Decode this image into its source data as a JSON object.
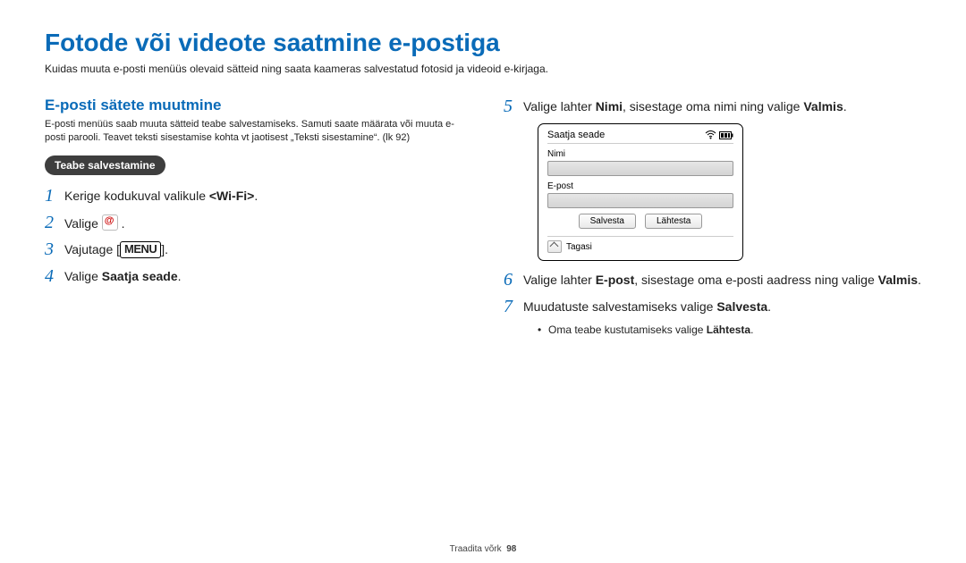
{
  "title": "Fotode või videote saatmine e-postiga",
  "intro": "Kuidas muuta e-posti menüüs olevaid sätteid ning saata kaameras salvestatud fotosid ja videoid e-kirjaga.",
  "left": {
    "subhead": "E-posti sätete muutmine",
    "subdesc": "E-posti menüüs saab muuta sätteid teabe salvestamiseks. Samuti saate määrata või muuta e-posti parooli. Teavet teksti sisestamise kohta vt jaotisest „Teksti sisestamine“. (lk 92)",
    "pill": "Teabe salvestamine",
    "steps": {
      "s1": {
        "num": "1",
        "pre": "Kerige kodukuval valikule ",
        "bold": "<Wi-Fi>",
        "post": "."
      },
      "s2": {
        "num": "2",
        "pre": "Valige ",
        "post": " ."
      },
      "s3": {
        "num": "3",
        "pre": "Vajutage [",
        "menu": "MENU",
        "post": "]."
      },
      "s4": {
        "num": "4",
        "pre": "Valige ",
        "bold": "Saatja seade",
        "post": "."
      }
    }
  },
  "right": {
    "s5": {
      "num": "5",
      "pre": "Valige lahter ",
      "b1": "Nimi",
      "mid": ", sisestage oma nimi ning valige ",
      "b2": "Valmis",
      "post": "."
    },
    "device": {
      "header": "Saatja seade",
      "labelName": "Nimi",
      "labelEmail": "E-post",
      "btnSave": "Salvesta",
      "btnReset": "Lähtesta",
      "back": "Tagasi"
    },
    "s6": {
      "num": "6",
      "pre": "Valige lahter ",
      "b1": "E-post",
      "mid": ", sisestage oma e-posti aadress ning valige ",
      "b2": "Valmis",
      "post": "."
    },
    "s7": {
      "num": "7",
      "pre": "Muudatuste salvestamiseks valige ",
      "b1": "Salvesta",
      "post": "."
    },
    "bullet": "Oma teabe kustutamiseks valige ",
    "bullet_b": "Lähtesta",
    "bullet_post": "."
  },
  "footer": {
    "label": "Traadita võrk",
    "page": "98"
  }
}
